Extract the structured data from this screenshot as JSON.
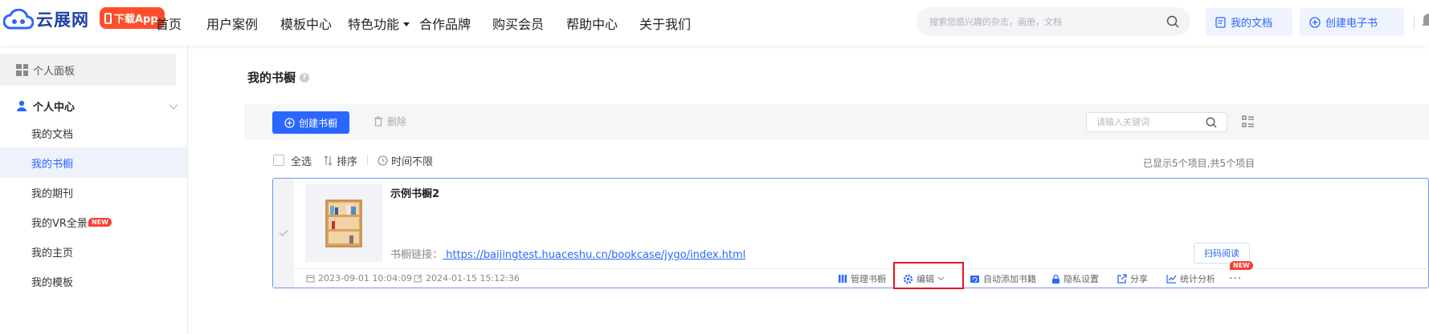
{
  "header": {
    "brand": "云展网",
    "app_badge": "下载App",
    "nav": [
      {
        "label": "首页"
      },
      {
        "label": "用户案例"
      },
      {
        "label": "模板中心"
      },
      {
        "label": "特色功能"
      },
      {
        "label": "合作品牌"
      },
      {
        "label": "购买会员"
      },
      {
        "label": "帮助中心"
      },
      {
        "label": "关于我们"
      }
    ],
    "search_placeholder": "搜索您感兴趣的杂志，画册，文档",
    "my_docs": "我的文档",
    "create_ebook": "创建电子书",
    "accent_color": "#2b67ff"
  },
  "sidebar": {
    "panel": "个人面板",
    "center": "个人中心",
    "items": [
      {
        "label": "我的文档"
      },
      {
        "label": "我的书橱"
      },
      {
        "label": "我的期刊"
      },
      {
        "label": "我的VR全景",
        "badge": "NEW"
      },
      {
        "label": "我的主页"
      },
      {
        "label": "我的模板"
      }
    ]
  },
  "main": {
    "title": "我的书橱",
    "toolbar": {
      "create": "创建书橱",
      "delete": "删除",
      "keyword_placeholder": "请输入关键词"
    },
    "filters": {
      "select_all": "全选",
      "sort": "排序",
      "time": "时间不限"
    },
    "summary": "已显示5个项目,共5个项目",
    "card": {
      "title": "示例书橱2",
      "link_label": "书橱链接：",
      "link_url": " https://baijingtest.huaceshu.cn/bookcase/jygo/index.html",
      "scan": "扫码阅读",
      "created": "2023-09-01 10:04:09",
      "updated": "2024-01-15 15:12:36",
      "actions": {
        "manage": "管理书橱",
        "edit": "编辑",
        "auto_add": "自动添加书籍",
        "privacy": "隐私设置",
        "share": "分享",
        "stats": "统计分析",
        "stats_badge": "NEW",
        "more": "..."
      }
    }
  }
}
